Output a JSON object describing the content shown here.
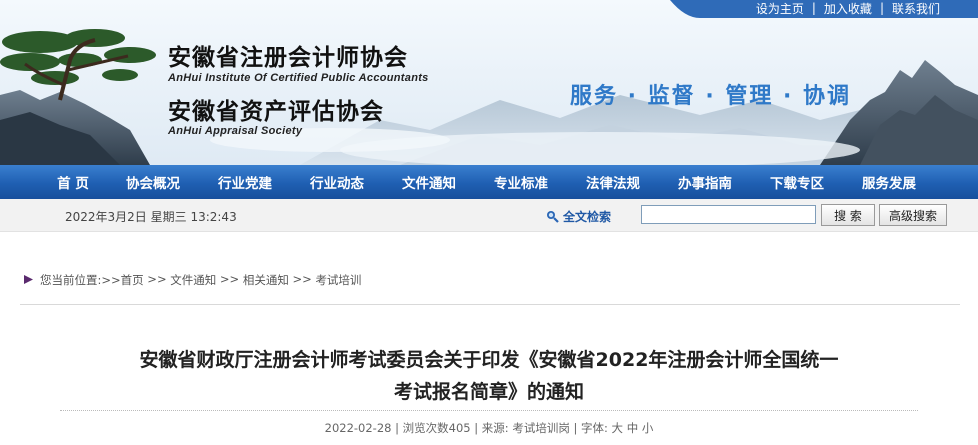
{
  "top_links": [
    "设为主页",
    "加入收藏",
    "联系我们"
  ],
  "org": {
    "name_cn_1": "安徽省注册会计师协会",
    "name_en_1": "AnHui Institute Of Certified Public Accountants",
    "name_cn_2": "安徽省资产评估协会",
    "name_en_2": "AnHui Appraisal Society",
    "slogan": "服务 · 监督 · 管理 · 协调"
  },
  "nav": [
    "首 页",
    "协会概况",
    "行业党建",
    "行业动态",
    "文件通知",
    "专业标准",
    "法律法规",
    "办事指南",
    "下载专区",
    "服务发展"
  ],
  "toolbar": {
    "date": "2022年3月2日 星期三 13:2:43",
    "fulltext_label": "全文检索",
    "search_value": "",
    "search_button": "搜 索",
    "advanced_button": "高级搜索"
  },
  "breadcrumb": {
    "prefix": "您当前位置:>>",
    "items": [
      "首页",
      "文件通知",
      "相关通知",
      "考试培训"
    ],
    "sep": " >> "
  },
  "article": {
    "title_line1": "安徽省财政厅注册会计师考试委员会关于印发《安徽省2022年注册会计师全国统一",
    "title_line2": "考试报名简章》的通知",
    "date": "2022-02-28",
    "views": "浏览次数405",
    "source_label": "来源:",
    "source": "考试培训岗",
    "font_label": "字体:",
    "font_sizes": [
      "大",
      "中",
      "小"
    ]
  },
  "colors": {
    "nav_blue": "#1f5fb2",
    "slogan_blue": "#2f79c8",
    "link_blue": "#1f58a5"
  }
}
